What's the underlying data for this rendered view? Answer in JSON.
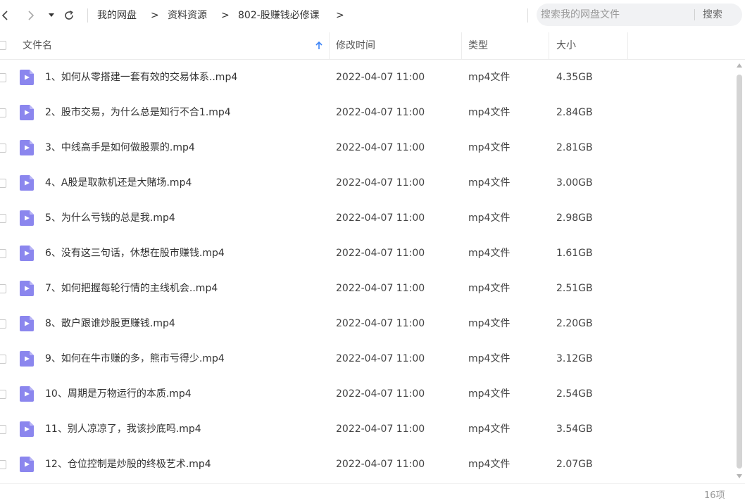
{
  "toolbar": {
    "back_icon": "chevron-left-icon",
    "forward_icon": "chevron-right-icon",
    "dropdown_icon": "caret-down-icon",
    "refresh_icon": "refresh-icon"
  },
  "breadcrumb": {
    "items": [
      "我的网盘",
      "资料资源",
      "802-股赚钱必修课"
    ],
    "separator": ">"
  },
  "search": {
    "placeholder": "搜索我的网盘文件",
    "value": "",
    "button_label": "搜索"
  },
  "table": {
    "columns": {
      "name": "文件名",
      "modified": "修改时间",
      "type": "类型",
      "size": "大小"
    },
    "sort_icon": "arrow-up-icon",
    "rows": [
      {
        "name": "1、如何从零搭建一套有效的交易体系..mp4",
        "modified": "2022-04-07 11:00",
        "type": "mp4文件",
        "size": "4.35GB"
      },
      {
        "name": "2、股市交易，为什么总是知行不合1.mp4",
        "modified": "2022-04-07 11:00",
        "type": "mp4文件",
        "size": "2.84GB"
      },
      {
        "name": "3、中线高手是如何做股票的.mp4",
        "modified": "2022-04-07 11:00",
        "type": "mp4文件",
        "size": "2.81GB"
      },
      {
        "name": "4、A股是取款机还是大赌场.mp4",
        "modified": "2022-04-07 11:00",
        "type": "mp4文件",
        "size": "3.00GB"
      },
      {
        "name": "5、为什么亏钱的总是我.mp4",
        "modified": "2022-04-07 11:00",
        "type": "mp4文件",
        "size": "2.98GB"
      },
      {
        "name": "6、没有这三句话，休想在股市赚钱.mp4",
        "modified": "2022-04-07 11:00",
        "type": "mp4文件",
        "size": "1.61GB"
      },
      {
        "name": "7、如何把握每轮行情的主线机会..mp4",
        "modified": "2022-04-07 11:00",
        "type": "mp4文件",
        "size": "2.51GB"
      },
      {
        "name": "8、散户跟谁炒股更赚钱.mp4",
        "modified": "2022-04-07 11:00",
        "type": "mp4文件",
        "size": "2.20GB"
      },
      {
        "name": "9、如何在牛市赚的多，熊市亏得少.mp4",
        "modified": "2022-04-07 11:00",
        "type": "mp4文件",
        "size": "3.12GB"
      },
      {
        "name": "10、周期是万物运行的本质.mp4",
        "modified": "2022-04-07 11:00",
        "type": "mp4文件",
        "size": "2.54GB"
      },
      {
        "name": "11、别人凉凉了，我该抄底吗.mp4",
        "modified": "2022-04-07 11:00",
        "type": "mp4文件",
        "size": "3.54GB"
      },
      {
        "name": "12、仓位控制是炒股的终极艺术.mp4",
        "modified": "2022-04-07 11:00",
        "type": "mp4文件",
        "size": "2.07GB"
      }
    ]
  },
  "footer": {
    "item_count": "16项"
  },
  "colors": {
    "file_icon": "#8b86ee",
    "sort_arrow": "#3b82f6",
    "search_bg": "#f1f2f4"
  }
}
